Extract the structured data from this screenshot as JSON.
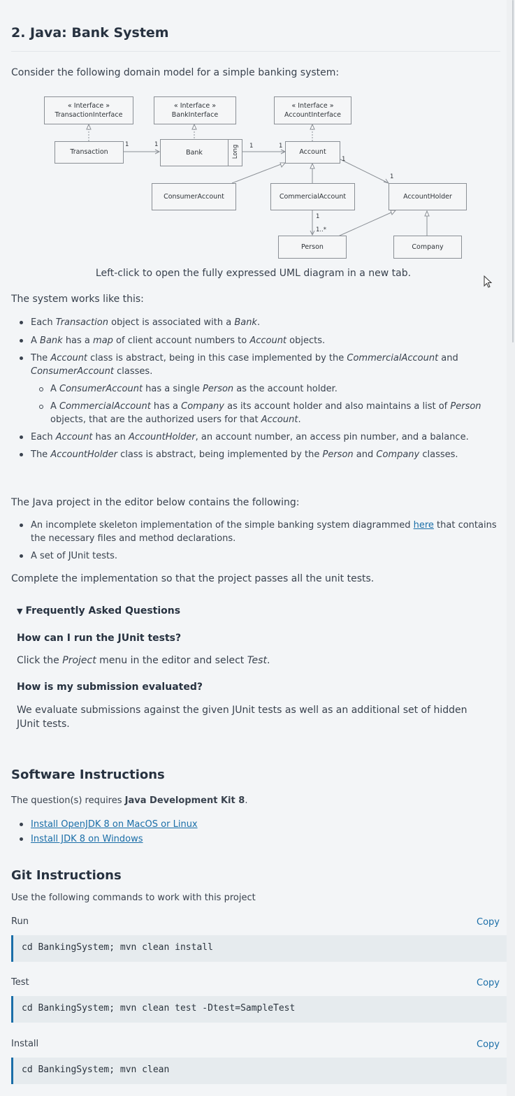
{
  "title": "2. Java: Bank System",
  "intro": "Consider the following domain model for a simple banking system:",
  "uml": {
    "transaction_interface": [
      "« Interface »",
      "TransactionInterface"
    ],
    "bank_interface": [
      "« Interface »",
      "BankInterface"
    ],
    "account_interface": [
      "« Interface »",
      "AccountInterface"
    ],
    "transaction": "Transaction",
    "bank": "Bank",
    "bank_key": "Long",
    "account": "Account",
    "consumer_account": "ConsumerAccount",
    "commercial_account": "CommercialAccount",
    "account_holder": "AccountHolder",
    "person": "Person",
    "company": "Company",
    "mult_one": "1",
    "mult_many": "1..*"
  },
  "caption": "Left-click to open the fully expressed UML diagram in a new tab.",
  "works_intro": "The system works like this:",
  "bullets": {
    "b1": [
      "Each ",
      "Transaction",
      " object is associated with a ",
      "Bank",
      "."
    ],
    "b2": [
      "A ",
      "Bank",
      " has a ",
      "map",
      " of client account numbers to ",
      "Account",
      " objects."
    ],
    "b3": [
      "The ",
      "Account",
      " class is abstract, being in this case implemented by the ",
      "CommercialAccount",
      " and ",
      "ConsumerAccount",
      " classes."
    ],
    "b3a": [
      "A ",
      "ConsumerAccount",
      " has a single ",
      "Person",
      " as the account holder."
    ],
    "b3b": [
      "A ",
      "CommercialAccount",
      " has a ",
      "Company",
      " as its account holder and also maintains a list of ",
      "Person",
      " objects, that are the authorized users for that ",
      "Account",
      "."
    ],
    "b4": [
      "Each ",
      "Account",
      " has an ",
      "AccountHolder",
      ", an account number, an access pin number, and a balance."
    ],
    "b5": [
      "The ",
      "AccountHolder",
      " class is abstract, being implemented by the ",
      "Person",
      " and ",
      "Company",
      " classes."
    ]
  },
  "project_intro": "The Java project in the editor below contains the following:",
  "project_items": {
    "p1_before": "An incomplete skeleton implementation of the simple banking system diagrammed ",
    "p1_link": "here",
    "p1_after": " that contains the necessary files and method declarations.",
    "p2": "A set of JUnit tests."
  },
  "complete_text": "Complete the implementation so that the project passes all the unit tests.",
  "faq": {
    "heading": "Frequently Asked Questions",
    "q1": "How can I run the JUnit tests?",
    "a1": [
      "Click the ",
      "Project",
      " menu in the editor and select ",
      "Test",
      "."
    ],
    "q2": "How is my submission evaluated?",
    "a2": "We evaluate submissions against the given JUnit tests as well as an additional set of hidden JUnit tests."
  },
  "software": {
    "heading": "Software Instructions",
    "text_before": "The question(s) requires ",
    "text_bold": "Java Development Kit 8",
    "text_after": ".",
    "link1": "Install OpenJDK 8 on MacOS or Linux",
    "link2": "Install JDK 8 on Windows"
  },
  "git": {
    "heading": "Git Instructions",
    "intro": "Use the following commands to work with this project",
    "copy_label": "Copy",
    "commands": [
      {
        "label": "Run",
        "code": "cd BankingSystem; mvn clean install"
      },
      {
        "label": "Test",
        "code": "cd BankingSystem; mvn clean test -Dtest=SampleTest"
      },
      {
        "label": "Install",
        "code": "cd BankingSystem; mvn clean"
      }
    ]
  },
  "colors": {
    "link": "#1a6ea8",
    "code_bg": "#e6ebee",
    "page_bg": "#f3f5f7"
  }
}
